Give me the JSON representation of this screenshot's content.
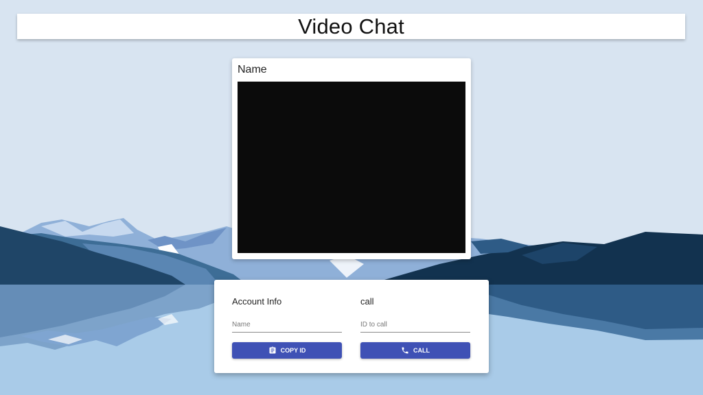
{
  "header": {
    "title": "Video Chat"
  },
  "video_card": {
    "name_label": "Name"
  },
  "account_panel": {
    "heading": "Account Info",
    "name_placeholder": "Name",
    "copy_button_label": "COPY ID",
    "copy_icon": "clipboard-icon"
  },
  "call_panel": {
    "heading": "call",
    "id_placeholder": "ID to call",
    "call_button_label": "CALL",
    "call_icon": "phone-icon"
  },
  "colors": {
    "accent": "#3f51b5",
    "sky": "#d8e4f1",
    "water": "#a9cbe8",
    "video_bg": "#0b0b0b"
  }
}
